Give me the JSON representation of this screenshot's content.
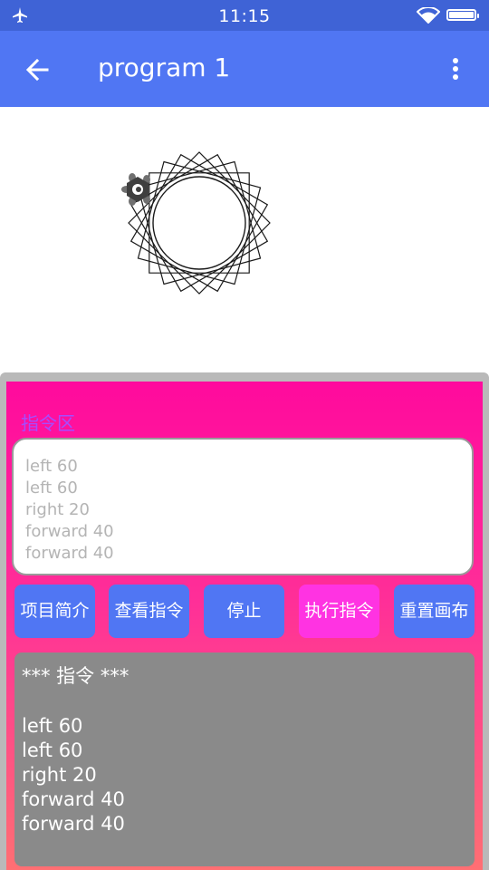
{
  "status_bar": {
    "time": "11:15",
    "icons": [
      "airplane-icon",
      "wifi-icon",
      "battery-icon"
    ]
  },
  "app_bar": {
    "title": "program 1",
    "back_icon": "arrow-left-icon",
    "menu_icon": "more-vert-icon",
    "color": "#5076f3"
  },
  "canvas": {
    "turtle_icon": "turtle-icon"
  },
  "panel": {
    "title": "指令区",
    "input_lines": [
      "left 60",
      "left 60",
      "right 20",
      "forward 40",
      "forward 40"
    ],
    "buttons": {
      "intro": "项目简介",
      "view": "查看指令",
      "stop": "停止",
      "execute": "执行指令",
      "reset": "重置画布"
    },
    "output": {
      "header": "*** 指令 ***",
      "lines": [
        "left 60",
        "left 60",
        "right 20",
        "forward 40",
        "forward 40"
      ]
    }
  },
  "colors": {
    "status_bar": "#3f63d6",
    "accent_blue": "#5076f3",
    "panel_pink": "#ff0a9d",
    "execute_button": "#ff33e2",
    "output_bg": "#8a8a8a"
  }
}
